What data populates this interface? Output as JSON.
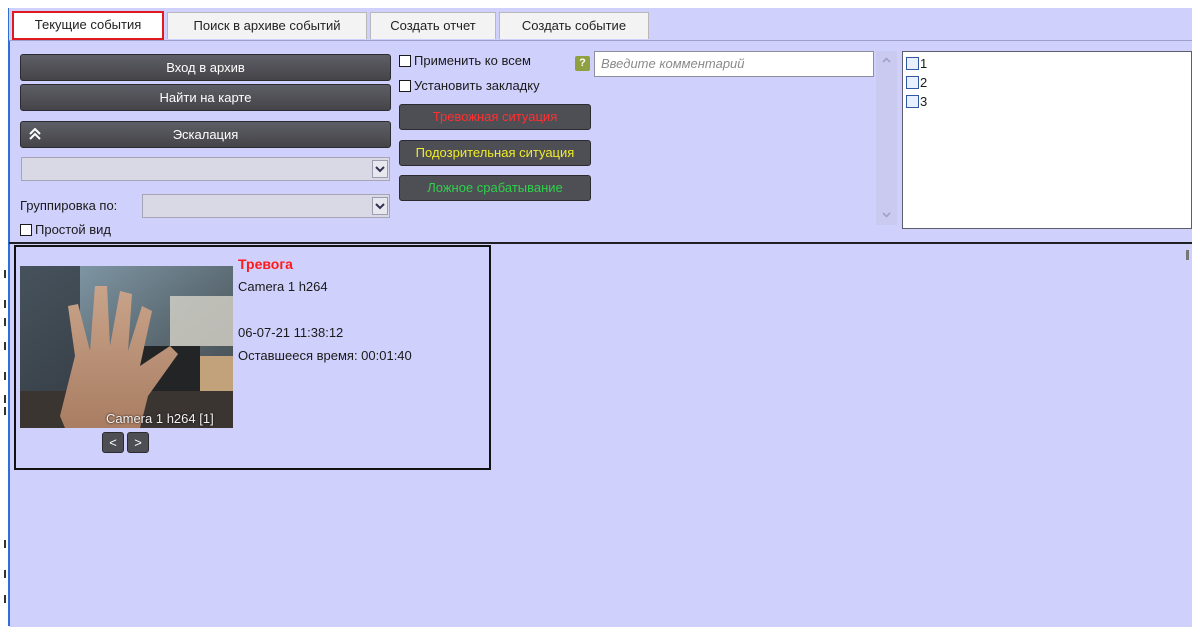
{
  "tabs": [
    {
      "label": "Текущие события",
      "active": true
    },
    {
      "label": "Поиск в архиве событий",
      "active": false
    },
    {
      "label": "Создать отчет",
      "active": false
    },
    {
      "label": "Создать событие",
      "active": false
    }
  ],
  "actions": {
    "archive_button": "Вход в архив",
    "map_button": "Найти на карте",
    "escalation_button": "Эскалация",
    "group_by_label": "Группировка по:",
    "simple_view_label": "Простой вид",
    "apply_all_label": "Применить ко всем",
    "bookmark_label": "Установить закладку",
    "comment_placeholder": "Введите комментарий",
    "help_label": "?",
    "alarm_button": "Тревожная ситуация",
    "suspicious_button": "Подозрительная ситуация",
    "false_button": "Ложное срабатывание"
  },
  "status_colors": {
    "alarm": "#ff3030",
    "suspicious": "#f0ec2a",
    "false": "#2ed14a"
  },
  "checklist": [
    {
      "label": "1",
      "checked": false
    },
    {
      "label": "2",
      "checked": false
    },
    {
      "label": "3",
      "checked": false
    }
  ],
  "event": {
    "title": "Тревога",
    "camera": "Camera 1 h264",
    "datetime": "06-07-21 11:38:12",
    "remaining": "Оставшееся время: 00:01:40",
    "thumbnail_caption": "Camera 1 h264 [1]",
    "prev_label": "<",
    "next_label": ">"
  },
  "icons": {
    "escalation": "double-chevron-up-icon",
    "dropdown": "chevron-down-icon",
    "scroll_up": "scroll-up-icon",
    "scroll_down": "scroll-down-icon"
  }
}
